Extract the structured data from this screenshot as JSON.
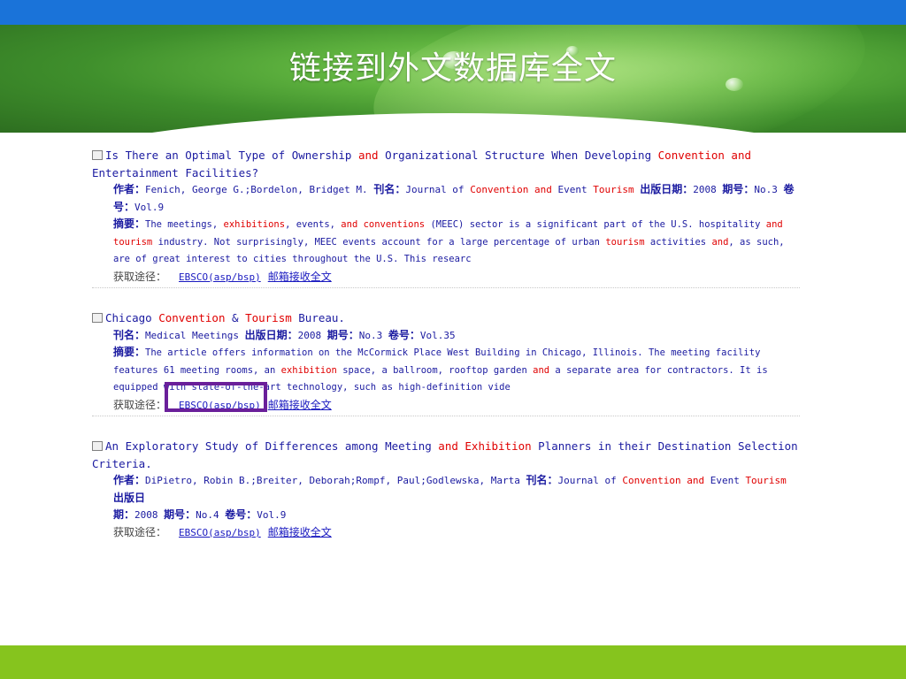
{
  "slide_title": "链接到外文数据库全文",
  "labels": {
    "author": "作者：",
    "journal": "刊名：",
    "pub_date": "出版日期：",
    "issue": "期号：",
    "volume": "卷号：",
    "abstract": "摘要：",
    "access": "获取途径：",
    "ebsco_link": "EBSCO(asp/bsp)",
    "email_fulltext": "邮箱接收全文"
  },
  "records": [
    {
      "title_pre": "Is There an Optimal Type of Ownership ",
      "title_hl1": "and",
      "title_mid": " Organizational Structure When Developing ",
      "title_hl2": "Convention and",
      "title_post": "Entertainment Facilities?",
      "authors": "Fenich, George G.;Bordelon, Bridget M.",
      "journal_pre": "Journal of ",
      "journal_hl1": "Convention and",
      "journal_mid": " Event ",
      "journal_hl2": "Tourism",
      "date": "2008",
      "issue": "No.3",
      "vol_label_a": "卷",
      "vol_label_b": "号：",
      "volume": "Vol.9",
      "abstract_a": "The meetings, ",
      "abstract_hl1": "exhibitions",
      "abstract_b": ", events, ",
      "abstract_hl2": "and conventions",
      "abstract_c": " (MEEC) sector is a significant part of the U.S. hospitality ",
      "abstract_hl3": "and",
      "abstract_hl4": "tourism",
      "abstract_d": " industry. Not surprisingly, MEEC events account for a large percentage of urban ",
      "abstract_hl5": "tourism",
      "abstract_e": " activities ",
      "abstract_hl6": "and",
      "abstract_f": ", as such,",
      "abstract_g": "are of great interest to cities throughout the U.S. This researc"
    },
    {
      "title_pre": "Chicago ",
      "title_hl1": "Convention",
      "title_mid": " & ",
      "title_hl2": "Tourism",
      "title_post": " Bureau.",
      "journal": "Medical Meetings",
      "date": "2008",
      "issue": "No.3",
      "volume": "Vol.35",
      "abstract_a": "The article offers information on the McCormick Place West Building in Chicago, Illinois. The meeting facility",
      "abstract_b": "features 61 meeting rooms, an ",
      "abstract_hl1": "exhibition",
      "abstract_c": " space, a ballroom, rooftop garden ",
      "abstract_hl2": "and",
      "abstract_d": " a separate area for contractors. It is",
      "abstract_e": "equipped with state-of-the-art technology, such as high-definition vide"
    },
    {
      "title_pre": "An Exploratory Study of Differences among Meeting ",
      "title_hl1": "and Exhibition",
      "title_mid": " Planners in their Destination Selection",
      "title_post": "Criteria.",
      "authors": "DiPietro, Robin B.;Breiter, Deborah;Rompf, Paul;Godlewska, Marta",
      "journal_pre": "Journal of ",
      "journal_hl1": "Convention and",
      "journal_mid": " Event ",
      "journal_hl2": "Tourism",
      "date_label_a": "出版日",
      "date_label_b": "期：",
      "date": "2008",
      "issue": "No.4",
      "volume": "Vol.9"
    }
  ]
}
